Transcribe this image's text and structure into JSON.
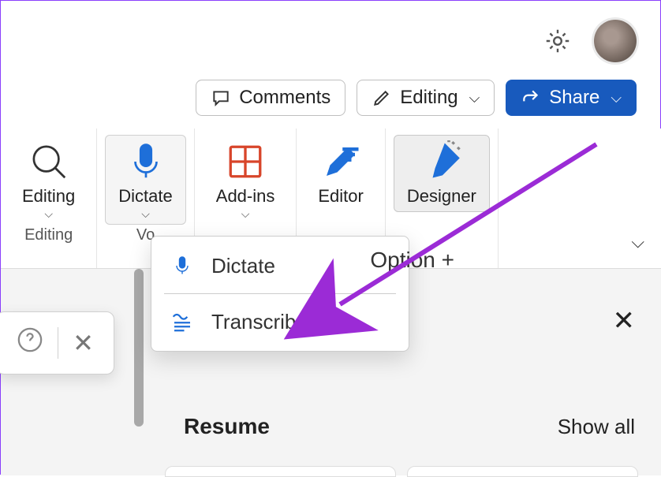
{
  "colors": {
    "accent": "#185abd",
    "annotation": "#9b2bd6"
  },
  "topbar": {
    "gear": "gear-icon",
    "avatar": "user-avatar"
  },
  "actions": {
    "comments": "Comments",
    "editing": "Editing",
    "share": "Share"
  },
  "ribbon": {
    "items": [
      {
        "label": "Editing",
        "icon": "magnifier-icon",
        "has_chev": true,
        "group": "Editing"
      },
      {
        "label": "Dictate",
        "icon": "microphone-icon",
        "has_chev": true,
        "group": "Voice",
        "active": true,
        "group_label_visible": "Vo"
      },
      {
        "label": "Add-ins",
        "icon": "addins-icon",
        "has_chev": true
      },
      {
        "label": "Editor",
        "icon": "editor-pen-icon",
        "has_chev": false
      },
      {
        "label": "Designer",
        "icon": "paintbrush-icon",
        "has_chev": false,
        "designer": true
      }
    ],
    "collapse_chevron": "ribbon-collapse"
  },
  "dropdown": {
    "items": [
      {
        "label": "Dictate",
        "icon": "microphone-icon"
      },
      {
        "label": "Transcribe",
        "icon": "transcribe-icon"
      }
    ],
    "shortcut_label": "Option +"
  },
  "panel": {
    "close_icon": "close-icon",
    "title": "Resume",
    "show_all": "Show all",
    "scrollbar": "scrollbar"
  },
  "floatbox": {
    "help_icon": "help-icon",
    "close_icon": "close-icon"
  },
  "annotation": "arrow-pointing-to-transcribe"
}
